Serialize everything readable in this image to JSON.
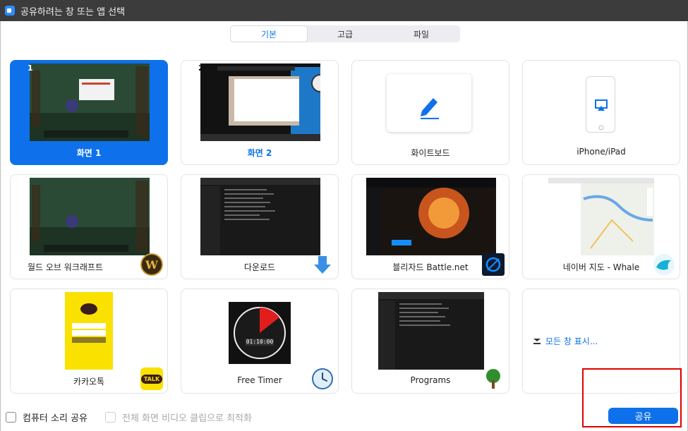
{
  "window": {
    "title": "공유하려는 창 또는 앱 선택"
  },
  "tabs": [
    {
      "label": "기본",
      "active": true
    },
    {
      "label": "고급",
      "active": false
    },
    {
      "label": "파일",
      "active": false
    }
  ],
  "items": [
    {
      "label": "화면 1",
      "screen_number": "1",
      "selected": true
    },
    {
      "label": "화면 2",
      "screen_number": "2",
      "selected": false
    },
    {
      "label": "화이트보드"
    },
    {
      "label": "iPhone/iPad"
    },
    {
      "label": "월드 오브 워크래프트",
      "icon": "world-of-warcraft-icon"
    },
    {
      "label": "다운로드",
      "icon": "download-arrow-icon"
    },
    {
      "label": "블리자드 Battle.net",
      "icon": "battlenet-icon"
    },
    {
      "label": "네이버 지도 - Whale",
      "icon": "whale-browser-icon"
    },
    {
      "label": "카카오톡",
      "icon": "kakaotalk-icon",
      "icon_text": "TALK"
    },
    {
      "label": "Free Timer",
      "icon": "clock-icon",
      "timer_display": "01:10:00"
    },
    {
      "label": "Programs",
      "icon": "tree-icon"
    },
    {
      "label": "모든 창 표시...",
      "icon": "expand-chevron-icon"
    }
  ],
  "footer": {
    "computer_sound": {
      "label": "컴퓨터 소리 공유",
      "checked": false
    },
    "optimize_video": {
      "label": "전체 화면 비디오 클립으로 최적화",
      "checked": false,
      "disabled": true
    },
    "share_button": "공유"
  },
  "colors": {
    "accent": "#0e71eb",
    "highlight_box": "#e00000"
  }
}
